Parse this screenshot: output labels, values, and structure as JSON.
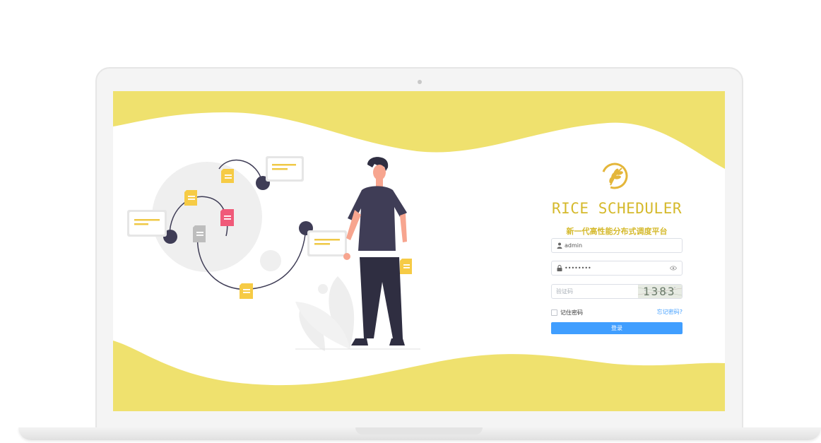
{
  "brand": {
    "title": "RICE SCHEDULER",
    "subtitle": "新一代高性能分布式调度平台",
    "logo_icon": "rice-ear-icon",
    "accent_color": "#d5b92b"
  },
  "form": {
    "username": {
      "value": "admin",
      "icon": "user-icon"
    },
    "password": {
      "value": "••••••••",
      "icon": "lock-icon",
      "toggle_icon": "eye-icon"
    },
    "captcha": {
      "placeholder": "验证码",
      "code": "1383"
    },
    "remember_label": "记住密码",
    "forgot_label": "忘记密码?",
    "submit_label": "登录",
    "button_color": "#409eff"
  },
  "theme": {
    "wave_color": "#efe16e",
    "illustration_dark": "#3f3d56"
  }
}
